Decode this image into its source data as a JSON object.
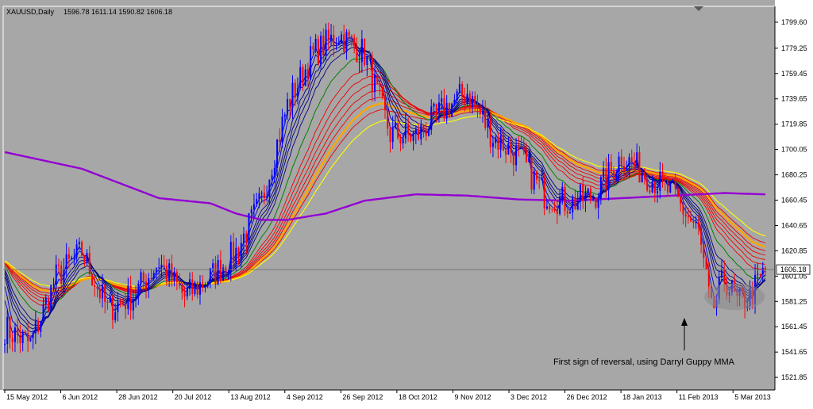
{
  "colors": {
    "plot_bg": "#a7a7a7",
    "frame": "#ffffff",
    "axis_text": "#000000",
    "bull_candle": "#0000ff",
    "bear_candle": "#ff0000",
    "gmma_short": "#000080",
    "gmma_short_fast": "#0000c8",
    "gmma_long": "#ee0000",
    "ema_green": "#008000",
    "ema_orange": "#ffa500",
    "ema_yellow": "#ffff00",
    "ema_purple": "#9400d3",
    "price_marker_bg": "#ffffff",
    "ellipse": "#8a8a8a"
  },
  "chart_data": {
    "type": "candlestick",
    "title": "XAUUSD,Daily",
    "ohlc_header": "1596.78 1611.14 1590.82 1606.18",
    "current_price_label": "1606.18",
    "current_price": 1606.18,
    "ylim": [
      1512.0,
      1812.0
    ],
    "y_ticks": [
      "1799.60",
      "1779.25",
      "1759.45",
      "1739.65",
      "1719.85",
      "1700.05",
      "1680.25",
      "1660.45",
      "1640.65",
      "1620.85",
      "1601.05",
      "1581.25",
      "1561.45",
      "1541.65",
      "1521.85"
    ],
    "x_ticks": [
      "15 May 2012",
      "6 Jun 2012",
      "28 Jun 2012",
      "20 Jul 2012",
      "13 Aug 2012",
      "4 Sep 2012",
      "26 Sep 2012",
      "18 Oct 2012",
      "9 Nov 2012",
      "3 Dec 2012",
      "26 Dec 2012",
      "18 Jan 2013",
      "11 Feb 2013",
      "5 Mar 2013"
    ],
    "price_path": {
      "x_index": [
        0,
        10,
        20,
        30,
        40,
        50,
        60,
        70,
        80,
        90,
        100,
        110,
        120,
        130,
        140,
        150,
        160,
        170,
        180,
        190,
        200,
        210,
        220,
        230,
        240,
        250,
        260,
        270,
        275,
        280,
        285,
        290,
        296
      ],
      "close": [
        1560,
        1548,
        1600,
        1620,
        1575,
        1586,
        1612,
        1585,
        1600,
        1620,
        1660,
        1735,
        1775,
        1790,
        1775,
        1712,
        1710,
        1730,
        1745,
        1710,
        1695,
        1665,
        1658,
        1665,
        1695,
        1680,
        1665,
        1635,
        1572,
        1600,
        1580,
        1585,
        1606
      ]
    },
    "ema_purple": {
      "x_index": [
        0,
        30,
        60,
        80,
        90,
        100,
        110,
        125,
        140,
        160,
        180,
        200,
        220,
        240,
        260,
        280,
        296
      ],
      "values": [
        1698,
        1685,
        1662,
        1658,
        1650,
        1645,
        1645,
        1650,
        1660,
        1665,
        1664,
        1661,
        1660,
        1662,
        1664,
        1666,
        1665
      ]
    },
    "annotation": "First sign of reversal, using Darryl Guppy MMA"
  }
}
